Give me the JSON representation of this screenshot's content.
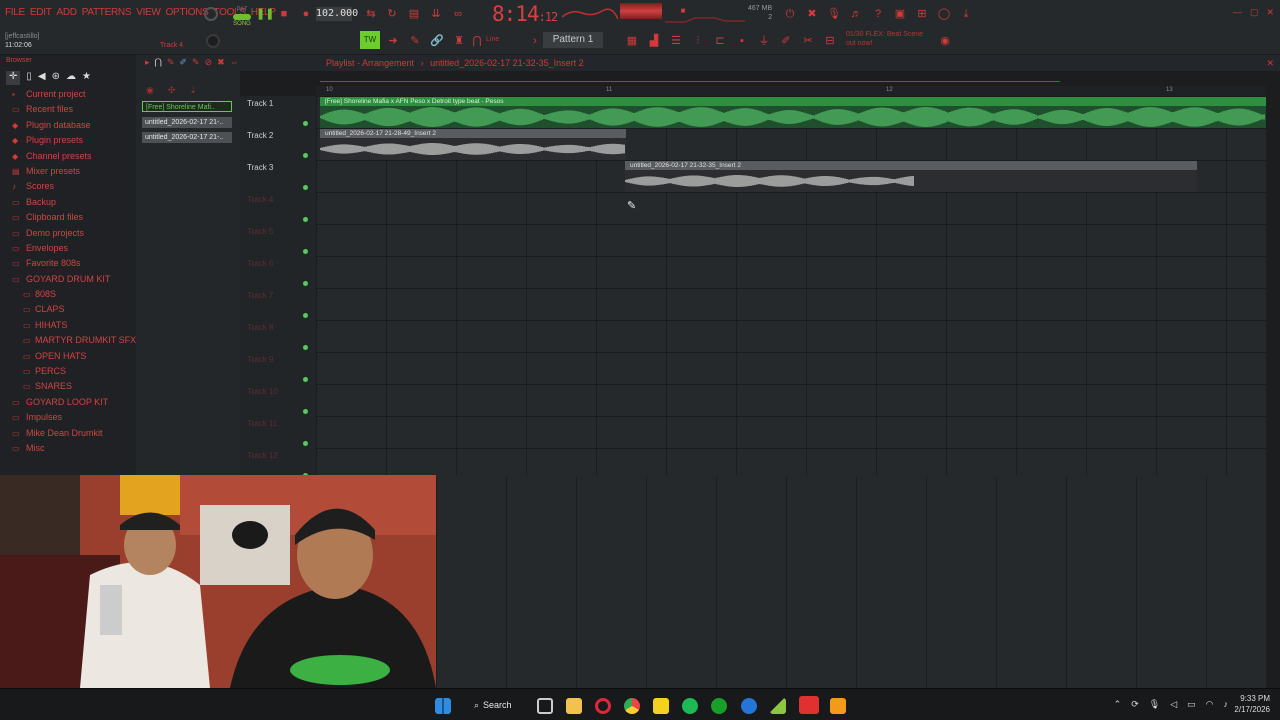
{
  "menu": [
    "FILE",
    "EDIT",
    "ADD",
    "PATTERNS",
    "VIEW",
    "OPTIONS",
    "TOOLS",
    "HELP"
  ],
  "hint": {
    "user": "[jeffcastillo]",
    "time": "11:02:06",
    "channel": "Track 4"
  },
  "transport": {
    "song_label": "SONG",
    "pat_label": "PAT",
    "tempo": "102.000",
    "clock_main": "8:14",
    "clock_sub": ":12"
  },
  "memory": {
    "line1": "467 MB",
    "line2": "2"
  },
  "pattern": "Pattern 1",
  "line_mode": "Line",
  "news": {
    "line1": "01/30  FLEX: Beat Scene",
    "line2": "out now!"
  },
  "browser": {
    "title": "Browser",
    "items": [
      {
        "label": "Current project",
        "icon": "current-project-icon",
        "sub": false
      },
      {
        "label": "Recent files",
        "icon": "folder-icon",
        "sub": false
      },
      {
        "label": "Plugin database",
        "icon": "plugin-icon",
        "sub": false
      },
      {
        "label": "Plugin presets",
        "icon": "plugin-icon",
        "sub": false
      },
      {
        "label": "Channel presets",
        "icon": "plugin-icon",
        "sub": false
      },
      {
        "label": "Mixer presets",
        "icon": "mixer-icon",
        "sub": false
      },
      {
        "label": "Scores",
        "icon": "score-icon",
        "sub": false
      },
      {
        "label": "Backup",
        "icon": "folder-icon",
        "sub": false
      },
      {
        "label": "Clipboard files",
        "icon": "folder-icon",
        "sub": false
      },
      {
        "label": "Demo projects",
        "icon": "folder-icon",
        "sub": false
      },
      {
        "label": "Envelopes",
        "icon": "folder-icon",
        "sub": false
      },
      {
        "label": "Favorite 808s",
        "icon": "folder-icon",
        "sub": false
      },
      {
        "label": "GOYARD DRUM KIT",
        "icon": "folder-open-icon",
        "sub": false
      },
      {
        "label": "808S",
        "icon": "folder-icon",
        "sub": true
      },
      {
        "label": "CLAPS",
        "icon": "folder-icon",
        "sub": true
      },
      {
        "label": "HIHATS",
        "icon": "folder-icon",
        "sub": true
      },
      {
        "label": "MARTYR DRUMKIT SFX",
        "icon": "folder-icon",
        "sub": true
      },
      {
        "label": "OPEN HATS",
        "icon": "folder-icon",
        "sub": true
      },
      {
        "label": "PERCS",
        "icon": "folder-icon",
        "sub": true
      },
      {
        "label": "SNARES",
        "icon": "folder-icon",
        "sub": true
      },
      {
        "label": "GOYARD LOOP KIT",
        "icon": "folder-icon",
        "sub": false
      },
      {
        "label": "Impulses",
        "icon": "folder-icon",
        "sub": false
      },
      {
        "label": "Mike Dean Drumkit",
        "icon": "folder-icon",
        "sub": false
      },
      {
        "label": "Misc",
        "icon": "folder-icon",
        "sub": false
      }
    ]
  },
  "picker": [
    "[Free] Shoreline Mafi..",
    "untitled_2026-02-17 21-..",
    "untitled_2026-02-17 21-.."
  ],
  "playlist": {
    "title": "Playlist - Arrangement",
    "sep": "›",
    "clip_name": "untitled_2026-02-17 21-32-35_Insert 2",
    "ruler": [
      "10",
      "11",
      "12",
      "13"
    ],
    "tracks": [
      "Track 1",
      "Track 2",
      "Track 3",
      "Track 4",
      "Track 5",
      "Track 6",
      "Track 7",
      "Track 8",
      "Track 9",
      "Track 10",
      "Track 11",
      "Track 12"
    ],
    "clips": [
      {
        "label": "[Free] Shoreline Mafia x AFN Peso x Detroit type beat - Pesos"
      },
      {
        "label": "untitled_2026-02-17 21-28-49_Insert 2"
      },
      {
        "label": "untitled_2026-02-17 21-32-35_Insert 2"
      }
    ]
  },
  "taskbar": {
    "search": "Search",
    "time": "9:33 PM",
    "date": "2/17/2026"
  },
  "colors": {
    "accent": "#d03a3a",
    "clip_green": "#2f8f40",
    "wave_green": "#55c46a",
    "panel": "#26292c"
  }
}
